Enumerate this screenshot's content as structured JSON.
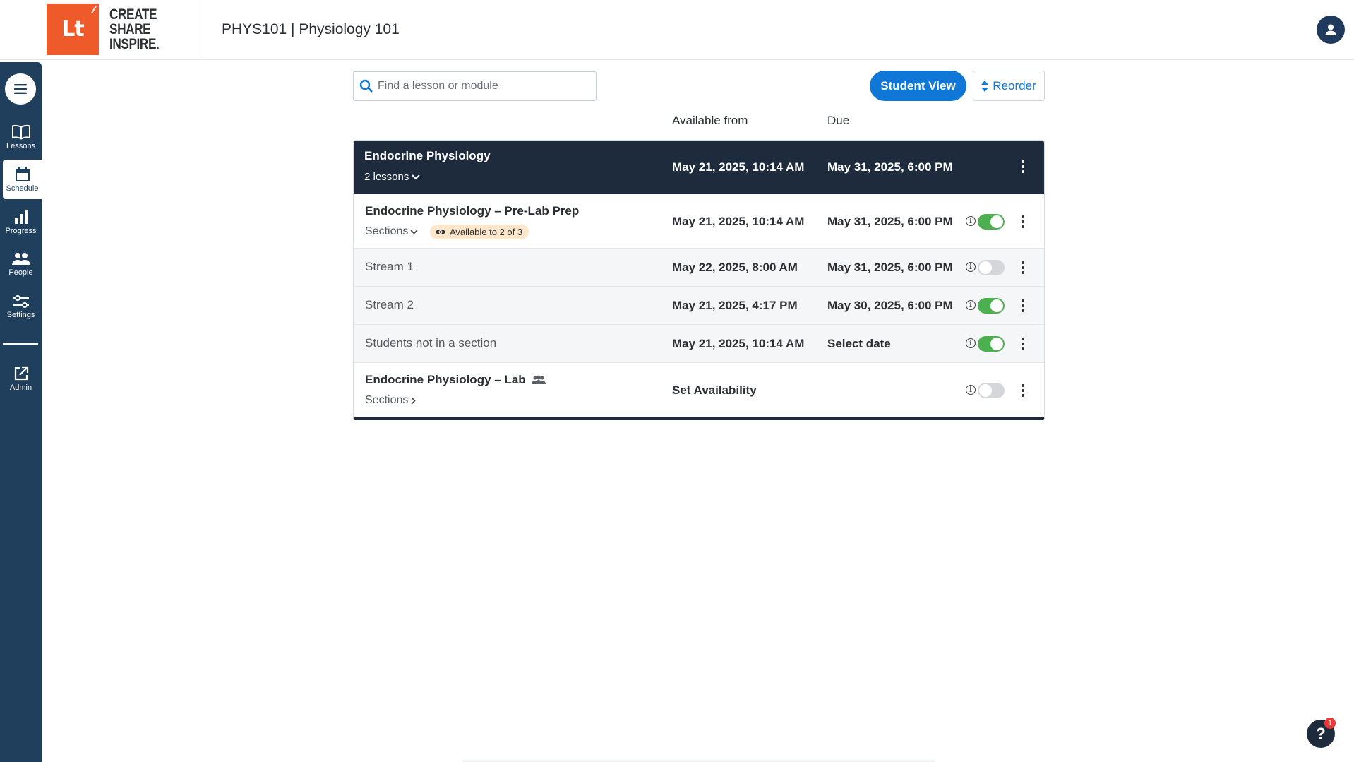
{
  "header": {
    "logo_letters": "Lt",
    "logo_tagline": [
      "CREATE",
      "SHARE",
      "INSPIRE."
    ],
    "course_title": "PHYS101 | Physiology 101"
  },
  "sidebar": {
    "items": [
      {
        "label": "Lessons",
        "icon": "book-icon"
      },
      {
        "label": "Schedule",
        "icon": "calendar-icon",
        "active": true
      },
      {
        "label": "Progress",
        "icon": "bar-chart-icon"
      },
      {
        "label": "People",
        "icon": "people-icon"
      },
      {
        "label": "Settings",
        "icon": "sliders-icon"
      },
      {
        "label": "Admin",
        "icon": "external-link-icon"
      }
    ]
  },
  "toolbar": {
    "search_placeholder": "Find a lesson or module",
    "student_view_label": "Student View",
    "reorder_label": "Reorder"
  },
  "columns": {
    "available_from": "Available from",
    "due": "Due"
  },
  "module": {
    "title": "Endocrine Physiology",
    "lessons_count": "2 lessons",
    "available_from": "May 21, 2025, 10:14 AM",
    "due": "May 31, 2025, 6:00 PM"
  },
  "lesson1": {
    "title": "Endocrine Physiology – Pre-Lab Prep",
    "sections_label": "Sections",
    "badge": "Available to 2 of 3",
    "available_from": "May 21, 2025, 10:14 AM",
    "due": "May 31, 2025, 6:00 PM",
    "enabled": true
  },
  "streams": [
    {
      "name": "Stream 1",
      "available_from": "May 22, 2025, 8:00 AM",
      "due": "May 31, 2025, 6:00 PM",
      "enabled": false
    },
    {
      "name": "Stream 2",
      "available_from": "May 21, 2025, 4:17 PM",
      "due": "May 30, 2025, 6:00 PM",
      "enabled": true
    },
    {
      "name": "Students not in a section",
      "available_from": "May 21, 2025, 10:14 AM",
      "due": "Select date",
      "enabled": true
    }
  ],
  "lesson2": {
    "title": "Endocrine Physiology – Lab",
    "sections_label": "Sections",
    "availability": "Set Availability",
    "enabled": false
  },
  "help": {
    "label": "?",
    "count": "1"
  },
  "colors": {
    "brand_orange": "#ef5a2b",
    "sidebar_navy": "#1f3f5d",
    "module_dark": "#1e2b3c",
    "accent_blue": "#1177d6",
    "toggle_green": "#4caf50"
  }
}
